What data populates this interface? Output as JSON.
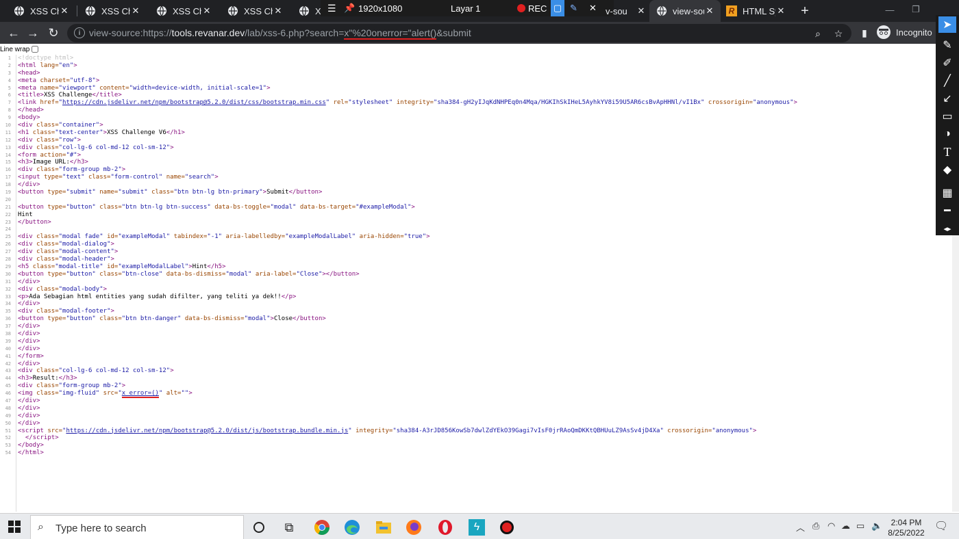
{
  "tabs": [
    {
      "title": "XSS Chall"
    },
    {
      "title": "XSS Chall"
    },
    {
      "title": "XSS Chall"
    },
    {
      "title": "XSS Chall"
    },
    {
      "title": "X"
    },
    {
      "title": "v-sou"
    },
    {
      "title": "view-sou"
    },
    {
      "title": "HTML Sy"
    }
  ],
  "recorder": {
    "resolution": "1920x1080",
    "layer": "Layar 1",
    "rec": "REC"
  },
  "address_bar": {
    "prefix": "view-source:https://",
    "domain": "tools.revanar.dev",
    "path": "/lab/xss-6.php?search=",
    "payload": "x\"%20onerror=\"alert()",
    "suffix": "&submit"
  },
  "profile": {
    "label": "Incognito"
  },
  "source_view": {
    "line_wrap_label": "Line wrap",
    "lines": [
      {
        "n": "1",
        "html": "<span class='dt'>&lt;!doctype html&gt;</span>"
      },
      {
        "n": "2",
        "html": "<span class='tg'>&lt;html</span> <span class='an'>lang=</span><span class='av'>\"en\"</span><span class='tg'>&gt;</span>"
      },
      {
        "n": "3",
        "html": "<span class='tg'>&lt;head&gt;</span>"
      },
      {
        "n": "4",
        "html": "<span class='tg'>&lt;meta</span> <span class='an'>charset=</span><span class='av'>\"utf-8\"</span><span class='tg'>&gt;</span>"
      },
      {
        "n": "5",
        "html": "<span class='tg'>&lt;meta</span> <span class='an'>name=</span><span class='av'>\"viewport\"</span> <span class='an'>content=</span><span class='av'>\"width=device-width, initial-scale=1\"</span><span class='tg'>&gt;</span>"
      },
      {
        "n": "6",
        "html": "<span class='tg'>&lt;title&gt;</span>XSS Challenge<span class='tg'>&lt;/title&gt;</span>"
      },
      {
        "n": "7",
        "html": "<span class='tg'>&lt;link</span> <span class='an'>href=</span><span class='av'>\"</span><span class='lk'>https://cdn.jsdelivr.net/npm/bootstrap@5.2.0/dist/css/bootstrap.min.css</span><span class='av'>\"</span> <span class='an'>rel=</span><span class='av'>\"stylesheet\"</span> <span class='an'>integrity=</span><span class='av'>\"sha384-gH2yIJqKdNHPEq0n4Mqa/HGKIhSkIHeL5AyhkYV8i59U5AR6csBvApHHNl/vI1Bx\"</span> <span class='an'>crossorigin=</span><span class='av'>\"anonymous\"</span><span class='tg'>&gt;</span>"
      },
      {
        "n": "8",
        "html": "<span class='tg'>&lt;/head&gt;</span>"
      },
      {
        "n": "9",
        "html": "<span class='tg'>&lt;body&gt;</span>"
      },
      {
        "n": "10",
        "html": "<span class='tg'>&lt;div</span> <span class='an'>class=</span><span class='av'>\"container\"</span><span class='tg'>&gt;</span>"
      },
      {
        "n": "11",
        "html": "<span class='tg'>&lt;h1</span> <span class='an'>class=</span><span class='av'>\"text-center\"</span><span class='tg'>&gt;</span>XSS Challenge V6<span class='tg'>&lt;/h1&gt;</span>"
      },
      {
        "n": "12",
        "html": "<span class='tg'>&lt;div</span> <span class='an'>class=</span><span class='av'>\"row\"</span><span class='tg'>&gt;</span>"
      },
      {
        "n": "13",
        "html": "<span class='tg'>&lt;div</span> <span class='an'>class=</span><span class='av'>\"col-lg-6 col-md-12 col-sm-12\"</span><span class='tg'>&gt;</span>"
      },
      {
        "n": "14",
        "html": "<span class='tg'>&lt;form</span> <span class='an'>action=</span><span class='av'>\"#\"</span><span class='tg'>&gt;</span>"
      },
      {
        "n": "15",
        "html": "<span class='tg'>&lt;h3&gt;</span>Image URL:<span class='tg'>&lt;/h3&gt;</span>"
      },
      {
        "n": "16",
        "html": "<span class='tg'>&lt;div</span> <span class='an'>class=</span><span class='av'>\"form-group mb-2\"</span><span class='tg'>&gt;</span>"
      },
      {
        "n": "17",
        "html": "<span class='tg'>&lt;input</span> <span class='an'>type=</span><span class='av'>\"text\"</span> <span class='an'>class=</span><span class='av'>\"form-control\"</span> <span class='an'>name=</span><span class='av'>\"search\"</span><span class='tg'>&gt;</span>"
      },
      {
        "n": "18",
        "html": "<span class='tg'>&lt;/div&gt;</span>"
      },
      {
        "n": "19",
        "html": "<span class='tg'>&lt;button</span> <span class='an'>type=</span><span class='av'>\"submit\"</span> <span class='an'>name=</span><span class='av'>\"submit\"</span> <span class='an'>class=</span><span class='av'>\"btn btn-lg btn-primary\"</span><span class='tg'>&gt;</span>Submit<span class='tg'>&lt;/button&gt;</span>"
      },
      {
        "n": "20",
        "html": ""
      },
      {
        "n": "21",
        "html": "<span class='tg'>&lt;button</span> <span class='an'>type=</span><span class='av'>\"button\"</span> <span class='an'>class=</span><span class='av'>\"btn btn-lg btn-success\"</span> <span class='an'>data-bs-toggle=</span><span class='av'>\"modal\"</span> <span class='an'>data-bs-target=</span><span class='av'>\"#exampleModal\"</span><span class='tg'>&gt;</span>"
      },
      {
        "n": "22",
        "html": "Hint"
      },
      {
        "n": "23",
        "html": "<span class='tg'>&lt;/button&gt;</span>"
      },
      {
        "n": "24",
        "html": ""
      },
      {
        "n": "25",
        "html": "<span class='tg'>&lt;div</span> <span class='an'>class=</span><span class='av'>\"modal fade\"</span> <span class='an'>id=</span><span class='av'>\"exampleModal\"</span> <span class='an'>tabindex=</span><span class='av'>\"-1\"</span> <span class='an'>aria-labelledby=</span><span class='av'>\"exampleModalLabel\"</span> <span class='an'>aria-hidden=</span><span class='av'>\"true\"</span><span class='tg'>&gt;</span>"
      },
      {
        "n": "26",
        "html": "<span class='tg'>&lt;div</span> <span class='an'>class=</span><span class='av'>\"modal-dialog\"</span><span class='tg'>&gt;</span>"
      },
      {
        "n": "27",
        "html": "<span class='tg'>&lt;div</span> <span class='an'>class=</span><span class='av'>\"modal-content\"</span><span class='tg'>&gt;</span>"
      },
      {
        "n": "28",
        "html": "<span class='tg'>&lt;div</span> <span class='an'>class=</span><span class='av'>\"modal-header\"</span><span class='tg'>&gt;</span>"
      },
      {
        "n": "29",
        "html": "<span class='tg'>&lt;h5</span> <span class='an'>class=</span><span class='av'>\"modal-title\"</span> <span class='an'>id=</span><span class='av'>\"exampleModalLabel\"</span><span class='tg'>&gt;</span>Hint<span class='tg'>&lt;/h5&gt;</span>"
      },
      {
        "n": "30",
        "html": "<span class='tg'>&lt;button</span> <span class='an'>type=</span><span class='av'>\"button\"</span> <span class='an'>class=</span><span class='av'>\"btn-close\"</span> <span class='an'>data-bs-dismiss=</span><span class='av'>\"modal\"</span> <span class='an'>aria-label=</span><span class='av'>\"Close\"</span><span class='tg'>&gt;&lt;/button&gt;</span>"
      },
      {
        "n": "31",
        "html": "<span class='tg'>&lt;/div&gt;</span>"
      },
      {
        "n": "32",
        "html": "<span class='tg'>&lt;div</span> <span class='an'>class=</span><span class='av'>\"modal-body\"</span><span class='tg'>&gt;</span>"
      },
      {
        "n": "33",
        "html": "<span class='tg'>&lt;p&gt;</span>Ada Sebagian html entities yang sudah difilter, yang teliti ya dek!!<span class='tg'>&lt;/p&gt;</span>"
      },
      {
        "n": "34",
        "html": "<span class='tg'>&lt;/div&gt;</span>"
      },
      {
        "n": "35",
        "html": "<span class='tg'>&lt;div</span> <span class='an'>class=</span><span class='av'>\"modal-footer\"</span><span class='tg'>&gt;</span>"
      },
      {
        "n": "36",
        "html": "<span class='tg'>&lt;button</span> <span class='an'>type=</span><span class='av'>\"button\"</span> <span class='an'>class=</span><span class='av'>\"btn btn-danger\"</span> <span class='an'>data-bs-dismiss=</span><span class='av'>\"modal\"</span><span class='tg'>&gt;</span>Close<span class='tg'>&lt;/button&gt;</span>"
      },
      {
        "n": "37",
        "html": "<span class='tg'>&lt;/div&gt;</span>"
      },
      {
        "n": "38",
        "html": "<span class='tg'>&lt;/div&gt;</span>"
      },
      {
        "n": "39",
        "html": "<span class='tg'>&lt;/div&gt;</span>"
      },
      {
        "n": "40",
        "html": "<span class='tg'>&lt;/div&gt;</span>"
      },
      {
        "n": "41",
        "html": "<span class='tg'>&lt;/form&gt;</span>"
      },
      {
        "n": "42",
        "html": "<span class='tg'>&lt;/div&gt;</span>"
      },
      {
        "n": "43",
        "html": "<span class='tg'>&lt;div</span> <span class='an'>class=</span><span class='av'>\"col-lg-6 col-md-12 col-sm-12\"</span><span class='tg'>&gt;</span>"
      },
      {
        "n": "44",
        "html": "<span class='tg'>&lt;h3&gt;</span>Result:<span class='tg'>&lt;/h3&gt;</span>"
      },
      {
        "n": "45",
        "html": "<span class='tg'>&lt;div</span> <span class='an'>class=</span><span class='av'>\"form-group mb-2\"</span><span class='tg'>&gt;</span>"
      },
      {
        "n": "46",
        "html": "<span class='tg'>&lt;img</span> <span class='an'>class=</span><span class='av'>\"img-fluid\"</span> <span class='an'>src=</span><span class='av'>\"</span><span class='lk redline'>x error=()</span><span class='av'>\"</span> <span class='an'>alt=</span><span class='av'>\"\"</span><span class='tg'>&gt;</span>"
      },
      {
        "n": "47",
        "html": "<span class='tg'>&lt;/div&gt;</span>"
      },
      {
        "n": "48",
        "html": "<span class='tg'>&lt;/div&gt;</span>"
      },
      {
        "n": "49",
        "html": "<span class='tg'>&lt;/div&gt;</span>"
      },
      {
        "n": "50",
        "html": "<span class='tg'>&lt;/div&gt;</span>"
      },
      {
        "n": "51",
        "html": "<span class='tg'>&lt;script</span> <span class='an'>src=</span><span class='av'>\"</span><span class='lk'>https://cdn.jsdelivr.net/npm/bootstrap@5.2.0/dist/js/bootstrap.bundle.min.js</span><span class='av'>\"</span> <span class='an'>integrity=</span><span class='av'>\"sha384-A3rJD856KowSb7dwlZdYEkO39Gagi7vIsF0jrRAoQmDKKtQBHUuLZ9AsSv4jD4Xa\"</span> <span class='an'>crossorigin=</span><span class='av'>\"anonymous\"</span><span class='tg'>&gt;</span>"
      },
      {
        "n": "52",
        "html": "  <span class='tg'>&lt;/script&gt;</span>"
      },
      {
        "n": "53",
        "html": "<span class='tg'>&lt;/body&gt;</span>"
      },
      {
        "n": "54",
        "html": "<span class='tg'>&lt;/html&gt;</span>"
      }
    ]
  },
  "taskbar": {
    "search_placeholder": "Type here to search",
    "time": "2:04 PM",
    "date": "8/25/2022"
  },
  "colors": {
    "tab_bg": "#202124",
    "toolbar_bg": "#35363a",
    "tag": "#881280",
    "attr_name": "#994500",
    "attr_value": "#1a1aa6",
    "annotation_red": "#e02020"
  }
}
